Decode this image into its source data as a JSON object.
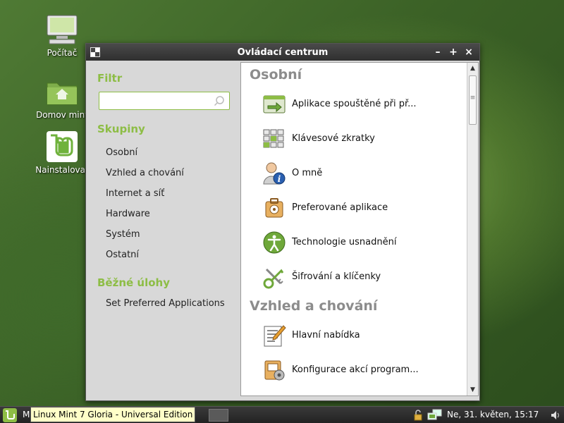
{
  "desktop": {
    "icons": [
      {
        "label": "Počítač"
      },
      {
        "label": "Domov mint"
      },
      {
        "label": "Nainstalovat"
      }
    ]
  },
  "window": {
    "title": "Ovládací centrum",
    "controls": {
      "minimize": "–",
      "maximize": "+",
      "close": "×"
    }
  },
  "sidebar": {
    "filter_heading": "Filtr",
    "search_placeholder": "",
    "groups_heading": "Skupiny",
    "groups": [
      "Osobní",
      "Vzhled a chování",
      "Internet a síť",
      "Hardware",
      "Systém",
      "Ostatní"
    ],
    "tasks_heading": "Běžné úlohy",
    "tasks": [
      "Set Preferred Applications"
    ]
  },
  "content": {
    "categories": [
      {
        "title": "Osobní",
        "items": [
          {
            "label": "Aplikace spouštěné při př...",
            "icon": "startup-apps-icon"
          },
          {
            "label": "Klávesové zkratky",
            "icon": "keyboard-shortcuts-icon"
          },
          {
            "label": "O mně",
            "icon": "about-me-icon"
          },
          {
            "label": "Preferované aplikace",
            "icon": "preferred-apps-icon"
          },
          {
            "label": "Technologie usnadnění",
            "icon": "accessibility-icon"
          },
          {
            "label": "Šifrování a klíčenky",
            "icon": "encryption-keyrings-icon"
          }
        ]
      },
      {
        "title": "Vzhled a chování",
        "items": [
          {
            "label": "Hlavní nabídka",
            "icon": "main-menu-icon"
          },
          {
            "label": "Konfigurace akcí program...",
            "icon": "file-actions-config-icon"
          }
        ]
      }
    ]
  },
  "panel": {
    "menu_label": "M",
    "tooltip": "Linux Mint 7 Gloria - Universal Edition",
    "clock": "Ne, 31. květen, 15:17"
  },
  "colors": {
    "accent_green": "#8dbd45",
    "category_gray": "#8c8c8c",
    "sidebar_bg": "#d8d8d8"
  }
}
